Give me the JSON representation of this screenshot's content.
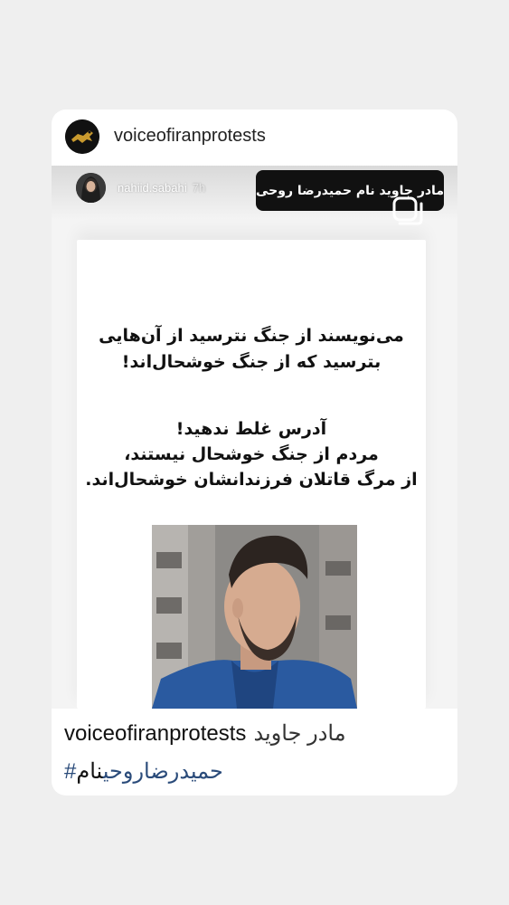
{
  "post": {
    "username": "voiceofiranprotests"
  },
  "story": {
    "username": "nahiid.sabahi",
    "time": "7h",
    "sticker_text": "مادر جاوید نام حمیدرضا روحی",
    "poster": {
      "line1": "می‌نویسند از جنگ نترسید از آن‌هایی",
      "line2": "بترسید که از جنگ خوشحال‌اند!",
      "line3": "آدرس غلط ندهید!",
      "line4": "مردم از جنگ خوشحال نیستند،",
      "line5": "از مرگ قاتلان فرزندانشان خوشحال‌اند."
    }
  },
  "caption": {
    "username": "voiceofiranprotests",
    "text": "مادر جاوید",
    "line2_prefix": "نام",
    "hashtag": "#حمیدرضاروحی"
  },
  "colors": {
    "background": "#efefef",
    "hashtag": "#2a4b7a"
  }
}
